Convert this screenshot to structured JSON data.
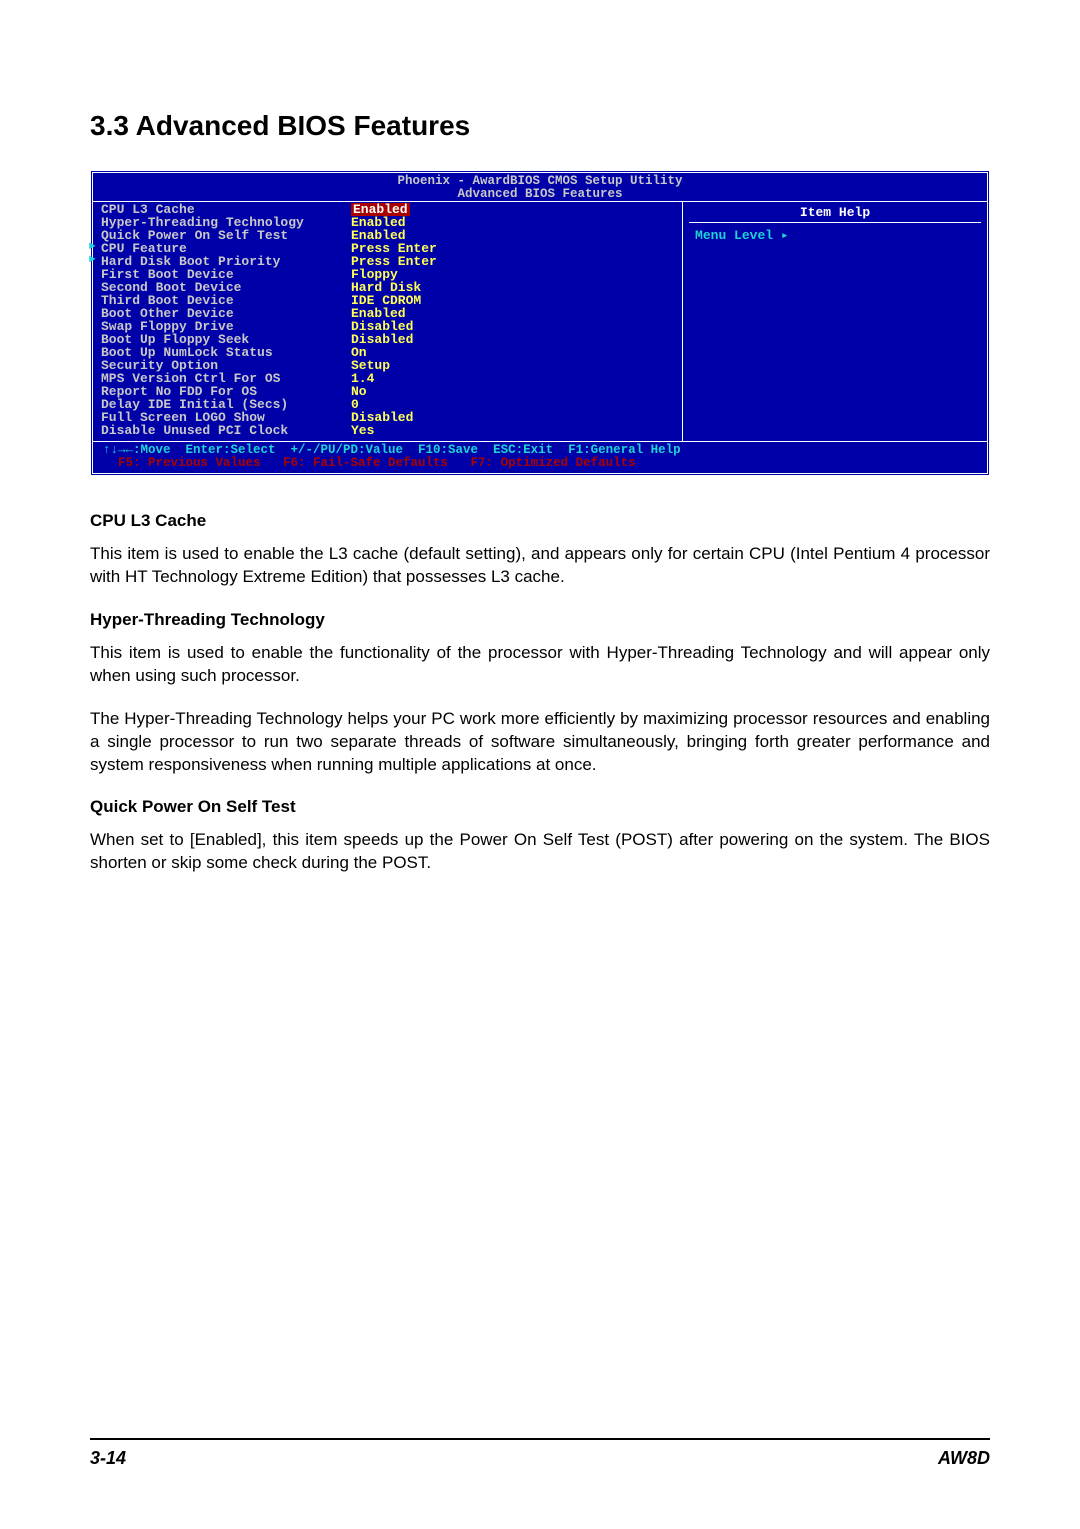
{
  "section_title": "3.3 Advanced BIOS Features",
  "bios": {
    "header_line1": "Phoenix - AwardBIOS CMOS Setup Utility",
    "header_line2": "Advanced BIOS Features",
    "options": [
      {
        "label": "CPU L3 Cache",
        "value": "Enabled",
        "submenu": false,
        "selected": true
      },
      {
        "label": "Hyper-Threading Technology",
        "value": "Enabled",
        "submenu": false
      },
      {
        "label": "Quick Power On Self Test",
        "value": "Enabled",
        "submenu": false
      },
      {
        "label": "CPU Feature",
        "value": "Press Enter",
        "submenu": true
      },
      {
        "label": "Hard Disk Boot Priority",
        "value": "Press Enter",
        "submenu": true
      },
      {
        "label": "First Boot Device",
        "value": "Floppy",
        "submenu": false
      },
      {
        "label": "Second Boot Device",
        "value": "Hard Disk",
        "submenu": false
      },
      {
        "label": "Third Boot Device",
        "value": "IDE CDROM",
        "submenu": false
      },
      {
        "label": "Boot Other Device",
        "value": "Enabled",
        "submenu": false
      },
      {
        "label": "Swap Floppy Drive",
        "value": "Disabled",
        "submenu": false
      },
      {
        "label": "Boot Up Floppy Seek",
        "value": "Disabled",
        "submenu": false
      },
      {
        "label": "Boot Up NumLock Status",
        "value": "On",
        "submenu": false
      },
      {
        "label": "Security Option",
        "value": "Setup",
        "submenu": false
      },
      {
        "label": "MPS Version Ctrl For OS",
        "value": "1.4",
        "submenu": false
      },
      {
        "label": "Report No FDD For OS",
        "value": "No",
        "submenu": false
      },
      {
        "label": "Delay IDE Initial (Secs)",
        "value": "0",
        "submenu": false
      },
      {
        "label": "Full Screen LOGO Show",
        "value": "Disabled",
        "submenu": false
      },
      {
        "label": "Disable Unused PCI Clock",
        "value": "Yes",
        "submenu": false
      }
    ],
    "help_title": "Item Help",
    "help_menu_level": "Menu Level   ▸",
    "footer_line1": "↑↓→←:Move  Enter:Select  +/-/PU/PD:Value  F10:Save  ESC:Exit  F1:General Help",
    "footer_line2": "  F5: Previous Values   F6: Fail-Safe Defaults   F7: Optimized Defaults"
  },
  "sections": [
    {
      "heading": "CPU L3 Cache",
      "paragraphs": [
        "This item is used to enable the L3 cache (default setting), and appears only for certain CPU (Intel Pentium 4 processor with HT Technology Extreme Edition) that possesses L3 cache."
      ]
    },
    {
      "heading": "Hyper-Threading Technology",
      "paragraphs": [
        "This item is used to enable the functionality of the processor with Hyper-Threading Technology and will appear only when using such processor.",
        "The Hyper-Threading Technology helps your PC work more efficiently by maximizing processor resources and enabling a single processor to run two separate threads of software simultaneously, bringing forth greater performance and system responsiveness when running multiple applications at once."
      ]
    },
    {
      "heading": "Quick Power On Self Test",
      "paragraphs": [
        "When set to [Enabled], this item speeds up the Power On Self Test (POST) after powering on the system. The BIOS shorten or skip some check during the POST."
      ]
    }
  ],
  "footer": {
    "page": "3-14",
    "model": "AW8D"
  }
}
